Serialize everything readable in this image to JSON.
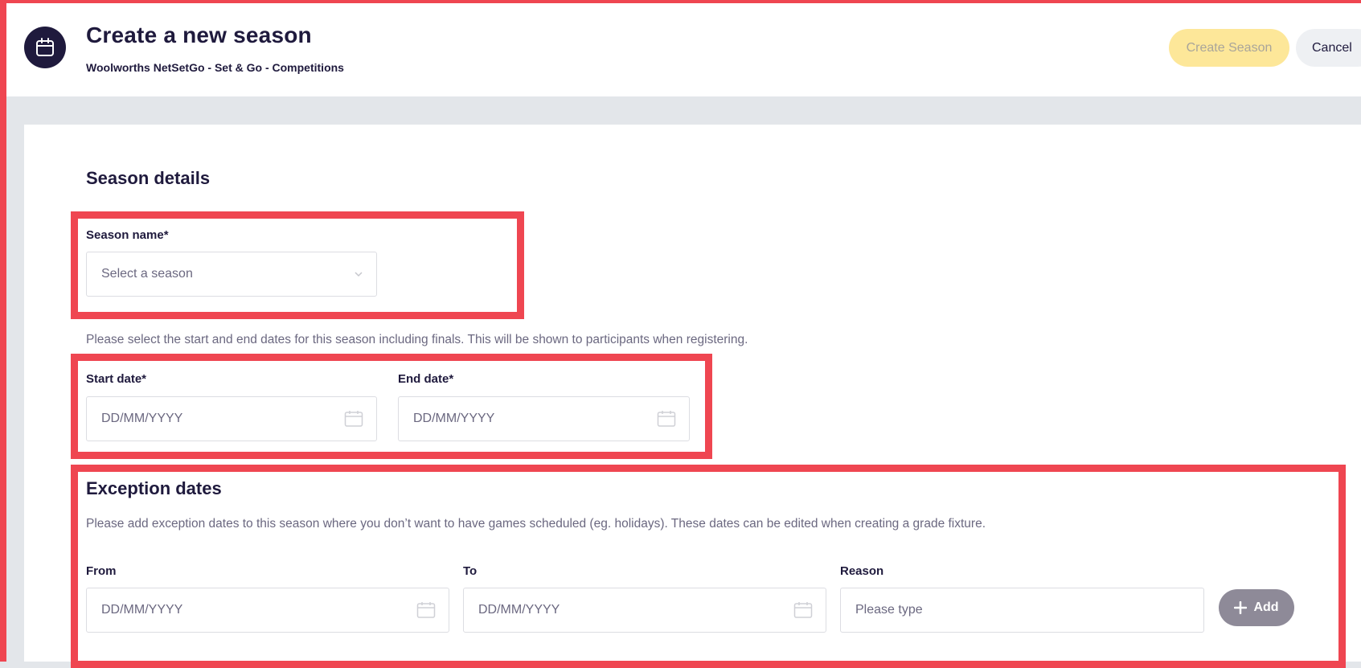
{
  "header": {
    "title": "Create a new season",
    "subtitle": "Woolworths NetSetGo - Set & Go - Competitions",
    "icon": "calendar-icon",
    "create_label": "Create Season",
    "cancel_label": "Cancel"
  },
  "season_details": {
    "title": "Season details",
    "season_name": {
      "label": "Season name*",
      "placeholder": "Select a season"
    },
    "dates_helper": "Please select the start and end dates for this season including finals. This will be shown to participants when registering.",
    "start_date": {
      "label": "Start date*",
      "placeholder": "DD/MM/YYYY"
    },
    "end_date": {
      "label": "End date*",
      "placeholder": "DD/MM/YYYY"
    }
  },
  "exception_dates": {
    "title": "Exception dates",
    "helper": "Please add exception dates to this season where you don’t want to have games scheduled (eg. holidays). These dates can be edited when creating a grade fixture.",
    "from": {
      "label": "From",
      "placeholder": "DD/MM/YYYY"
    },
    "to": {
      "label": "To",
      "placeholder": "DD/MM/YYYY"
    },
    "reason": {
      "label": "Reason",
      "placeholder": "Please type"
    },
    "add_label": "Add"
  },
  "colors": {
    "highlight": "#ef4651",
    "navy": "#1f1a3d",
    "create_button": "#fde799",
    "add_button": "#8e8a98"
  }
}
